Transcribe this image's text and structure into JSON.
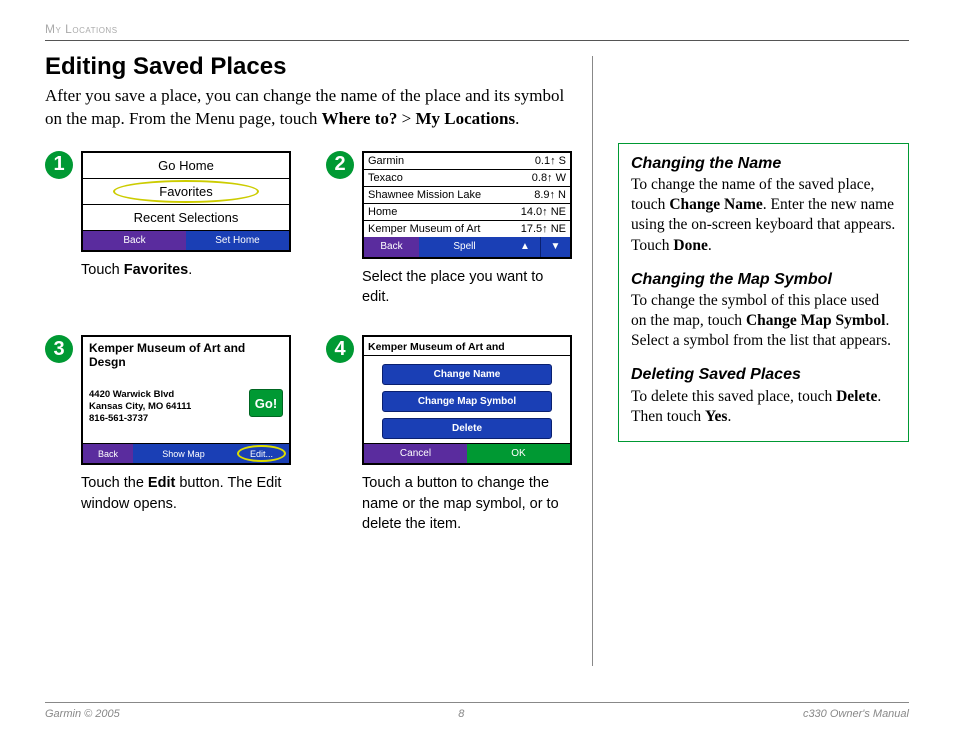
{
  "header": {
    "section": "My Locations"
  },
  "title": "Editing Saved Places",
  "intro": {
    "pre": "After you save a place, you can change the name of the place and its symbol on the map. From the Menu page, touch ",
    "bold1": "Where to?",
    "mid": " > ",
    "bold2": "My Locations",
    "post": "."
  },
  "steps": {
    "s1": {
      "num": "1",
      "rows": [
        "Go Home",
        "Favorites",
        "Recent Selections"
      ],
      "back": "Back",
      "sethome": "Set Home",
      "caption_pre": "Touch ",
      "caption_bold": "Favorites",
      "caption_post": "."
    },
    "s2": {
      "num": "2",
      "rows": [
        {
          "n": "Garmin",
          "d": "0.1↑ S"
        },
        {
          "n": "Texaco",
          "d": "0.8↑ W"
        },
        {
          "n": "Shawnee Mission Lake",
          "d": "8.9↑ N"
        },
        {
          "n": "Home",
          "d": "14.0↑ NE"
        },
        {
          "n": "Kemper Museum of Art",
          "d": "17.5↑ NE"
        }
      ],
      "back": "Back",
      "spell": "Spell",
      "up": "▲",
      "down": "▼",
      "caption": "Select the place you want to edit."
    },
    "s3": {
      "num": "3",
      "title": "Kemper Museum of Art and Desgn",
      "addr1": "4420 Warwick Blvd",
      "addr2": "Kansas City, MO 64111",
      "addr3": "816-561-3737",
      "go": "Go!",
      "back": "Back",
      "showmap": "Show Map",
      "edit": "Edit...",
      "caption_pre": "Touch the ",
      "caption_bold": "Edit",
      "caption_post": " button. The Edit window opens."
    },
    "s4": {
      "num": "4",
      "title": "Kemper Museum of Art and",
      "b1": "Change Name",
      "b2": "Change Map Symbol",
      "b3": "Delete",
      "cancel": "Cancel",
      "ok": "OK",
      "caption": "Touch a button to change the name or the map symbol, or to delete the item."
    }
  },
  "sidebar": {
    "h1": "Changing the Name",
    "p1a": "To change the name of the saved place, touch ",
    "p1b": "Change Name",
    "p1c": ". Enter the new name using the on-screen keyboard that appears. Touch ",
    "p1d": "Done",
    "p1e": ".",
    "h2": "Changing the Map Symbol",
    "p2a": "To change the symbol of this place used on the map, touch ",
    "p2b": "Change Map Symbol",
    "p2c": ". Select a symbol from the list that appears.",
    "h3": "Deleting Saved Places",
    "p3a": "To delete this saved place, touch ",
    "p3b": "Delete",
    "p3c": ". Then touch ",
    "p3d": "Yes",
    "p3e": "."
  },
  "footer": {
    "left": "Garmin © 2005",
    "center": "8",
    "right": "c330 Owner's Manual"
  }
}
